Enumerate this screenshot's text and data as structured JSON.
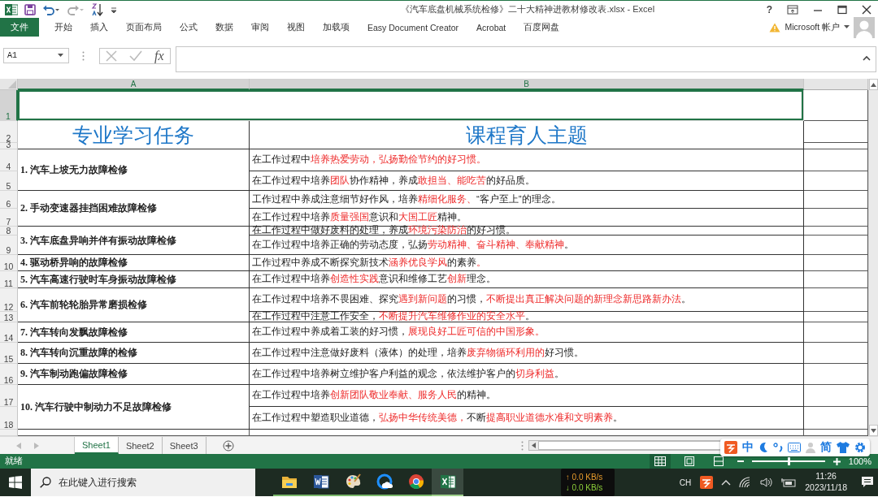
{
  "window": {
    "title": "《汽车底盘机械系统检修》二十大精神进教材修改表.xlsx - Excel",
    "help": "?"
  },
  "ribbon_tabs": [
    {
      "label": "文件",
      "kind": "file",
      "selected": false
    },
    {
      "label": "开始",
      "kind": "tab",
      "selected": false
    },
    {
      "label": "插入",
      "kind": "tab",
      "selected": false
    },
    {
      "label": "页面布局",
      "kind": "tab",
      "selected": false
    },
    {
      "label": "公式",
      "kind": "tab",
      "selected": false
    },
    {
      "label": "数据",
      "kind": "tab",
      "selected": false
    },
    {
      "label": "审阅",
      "kind": "tab",
      "selected": false
    },
    {
      "label": "视图",
      "kind": "tab",
      "selected": false
    },
    {
      "label": "加载项",
      "kind": "tab",
      "selected": false
    },
    {
      "label": "Easy Document Creator",
      "kind": "tab",
      "selected": false
    },
    {
      "label": "Acrobat",
      "kind": "tab",
      "selected": false
    },
    {
      "label": "百度网盘",
      "kind": "tab",
      "selected": false
    }
  ],
  "account": {
    "label": "Microsoft 帐户"
  },
  "formula_bar": {
    "name_box": "A1",
    "function_label": "fx"
  },
  "columns": [
    {
      "label": "A",
      "selected": true
    },
    {
      "label": "B",
      "selected": true
    }
  ],
  "rows": [
    {
      "label": "1",
      "selected": true
    },
    {
      "label": "2",
      "selected": false
    },
    {
      "label": "3",
      "selected": false
    },
    {
      "label": "4",
      "selected": false
    },
    {
      "label": "5",
      "selected": false
    },
    {
      "label": "6",
      "selected": false
    },
    {
      "label": "7",
      "selected": false
    },
    {
      "label": "8",
      "selected": false
    },
    {
      "label": "9",
      "selected": false
    },
    {
      "label": "10",
      "selected": false
    },
    {
      "label": "11",
      "selected": false
    },
    {
      "label": "12",
      "selected": false
    },
    {
      "label": "13",
      "selected": false
    },
    {
      "label": "14",
      "selected": false
    },
    {
      "label": "15",
      "selected": false
    },
    {
      "label": "16",
      "selected": false
    },
    {
      "label": "17",
      "selected": false
    },
    {
      "label": "18",
      "selected": false
    }
  ],
  "sheet": {
    "headers": [
      "专业学习任务",
      "课程育人主题"
    ],
    "tasks": [
      {
        "name": "1. 汽车上坡无力故障检修",
        "themes": [
          [
            {
              "text": "在工作过程中",
              "highlight": false
            },
            {
              "text": "培养热爱劳动，弘扬勤俭节约的好习惯。",
              "highlight": true
            }
          ],
          [
            {
              "text": "在工作过程中培养",
              "highlight": false
            },
            {
              "text": "团队",
              "highlight": true
            },
            {
              "text": "协作精神，养成",
              "highlight": false
            },
            {
              "text": "敢担当、能吃苦",
              "highlight": true
            },
            {
              "text": "的好品质。",
              "highlight": false
            }
          ]
        ]
      },
      {
        "name": "2. 手动变速器挂挡困难故障检修",
        "themes": [
          [
            {
              "text": "工作过程中养成注意细节好作风，培养",
              "highlight": false
            },
            {
              "text": "精细化服务、",
              "highlight": true
            },
            {
              "text": "“客户至上”的理念。",
              "highlight": false
            }
          ],
          [
            {
              "text": "在工作过程中培养",
              "highlight": false
            },
            {
              "text": "质量强国",
              "highlight": true
            },
            {
              "text": "意识和",
              "highlight": false
            },
            {
              "text": "大国工匠",
              "highlight": true
            },
            {
              "text": "精神。",
              "highlight": false
            }
          ]
        ]
      },
      {
        "name": "3. 汽车底盘异响并伴有振动故障检修",
        "themes": [
          [
            {
              "text": "在工作过程中做好废料的处理，养成",
              "highlight": false
            },
            {
              "text": "环境污染防治",
              "highlight": true
            },
            {
              "text": "的好习惯。",
              "highlight": false
            }
          ],
          [
            {
              "text": "在工作过程中培养正确的劳动态度，弘扬",
              "highlight": false
            },
            {
              "text": "劳动精神、奋斗精神、奉献精神",
              "highlight": true
            },
            {
              "text": "。",
              "highlight": false
            }
          ]
        ]
      },
      {
        "name": "4. 驱动桥异响的故障检修",
        "themes": [
          [
            {
              "text": "工作过程中养成不断探究新技术",
              "highlight": false
            },
            {
              "text": "涵养优良学风",
              "highlight": true
            },
            {
              "text": "的素养",
              "highlight": false
            },
            {
              "text": "。",
              "highlight": true
            }
          ]
        ]
      },
      {
        "name": "5. 汽车高速行驶时车身振动故障检修",
        "themes": [
          [
            {
              "text": "在工作过程中培养",
              "highlight": false
            },
            {
              "text": "创造性实践",
              "highlight": true
            },
            {
              "text": "意识和维修工艺",
              "highlight": false
            },
            {
              "text": "创新",
              "highlight": true
            },
            {
              "text": "理念。",
              "highlight": false
            }
          ]
        ]
      },
      {
        "name": "6. 汽车前轮轮胎异常磨损检修",
        "themes": [
          [
            {
              "text": "在工作过程中培养不畏困难、探究",
              "highlight": false
            },
            {
              "text": "遇到新问题",
              "highlight": true
            },
            {
              "text": "的习惯，",
              "highlight": false
            },
            {
              "text": "不断提出真正解决问题的新理念新思路新办法",
              "highlight": true
            },
            {
              "text": "。",
              "highlight": false
            }
          ],
          [
            {
              "text": "在工作过程中注意工作安全，",
              "highlight": false
            },
            {
              "text": "不断提升汽车维修作业的安全水平",
              "highlight": true
            },
            {
              "text": "。",
              "highlight": false
            }
          ]
        ]
      },
      {
        "name": "7. 汽车转向发飘故障检修",
        "themes": [
          [
            {
              "text": "在工作过程中养成着工装的好习惯，",
              "highlight": false
            },
            {
              "text": "展现良好工匠可信的中国形象。",
              "highlight": true
            }
          ]
        ]
      },
      {
        "name": "8. 汽车转向沉重故障的检修",
        "themes": [
          [
            {
              "text": "在工作过程中注意做好废料（液体）的处理，培养",
              "highlight": false
            },
            {
              "text": "废弃物循环利用的",
              "highlight": true
            },
            {
              "text": "好习惯。",
              "highlight": false
            }
          ]
        ]
      },
      {
        "name": "9. 汽车制动跑偏故障检修",
        "themes": [
          [
            {
              "text": "在工作过程中培养树立维护客户利益的观念，依法维护客户的",
              "highlight": false
            },
            {
              "text": "切身利益",
              "highlight": true
            },
            {
              "text": "。",
              "highlight": false
            }
          ]
        ]
      },
      {
        "name": "10. 汽车行驶中制动力不足故障检修",
        "themes": [
          [
            {
              "text": "在工作过程中培养",
              "highlight": false
            },
            {
              "text": "创新团队敬业奉献、服务人民",
              "highlight": true
            },
            {
              "text": "的精神。",
              "highlight": false
            }
          ],
          [
            {
              "text": "在工作过程中塑造职业道德，",
              "highlight": false
            },
            {
              "text": "弘扬中华传统美德，",
              "highlight": true
            },
            {
              "text": "不断",
              "highlight": false
            },
            {
              "text": "提高职业道德水准和文明素养",
              "highlight": true
            },
            {
              "text": "。",
              "highlight": false
            }
          ]
        ]
      }
    ]
  },
  "sheet_tabs": [
    {
      "label": "Sheet1",
      "selected": true
    },
    {
      "label": "Sheet2",
      "selected": false
    },
    {
      "label": "Sheet3",
      "selected": false
    }
  ],
  "status_bar": {
    "text": "就绪",
    "zoom": {
      "level": 0.5,
      "reading": "100%"
    }
  },
  "ime_bar": [
    {
      "kind": "logo"
    },
    {
      "kind": "text",
      "label": "中"
    },
    {
      "kind": "moon"
    },
    {
      "kind": "punct"
    },
    {
      "kind": "keyboard"
    },
    {
      "kind": "user"
    },
    {
      "kind": "text",
      "label": "简"
    },
    {
      "kind": "shirt"
    },
    {
      "kind": "gear"
    }
  ],
  "taskbar": {
    "search_placeholder": "在此键入进行搜索",
    "apps": [
      {
        "kind": "folder",
        "selected": false
      },
      {
        "kind": "word",
        "selected": false
      },
      {
        "kind": "paint",
        "selected": false
      },
      {
        "kind": "cloud",
        "selected": false
      },
      {
        "kind": "chrome",
        "selected": false
      },
      {
        "kind": "excel",
        "selected": true
      }
    ],
    "net_up": "↑ 0.0 KB/s",
    "net_down": "↓ 0.0 KB/s",
    "language": "CH",
    "time": "11:26",
    "date": "2023/11/18"
  }
}
